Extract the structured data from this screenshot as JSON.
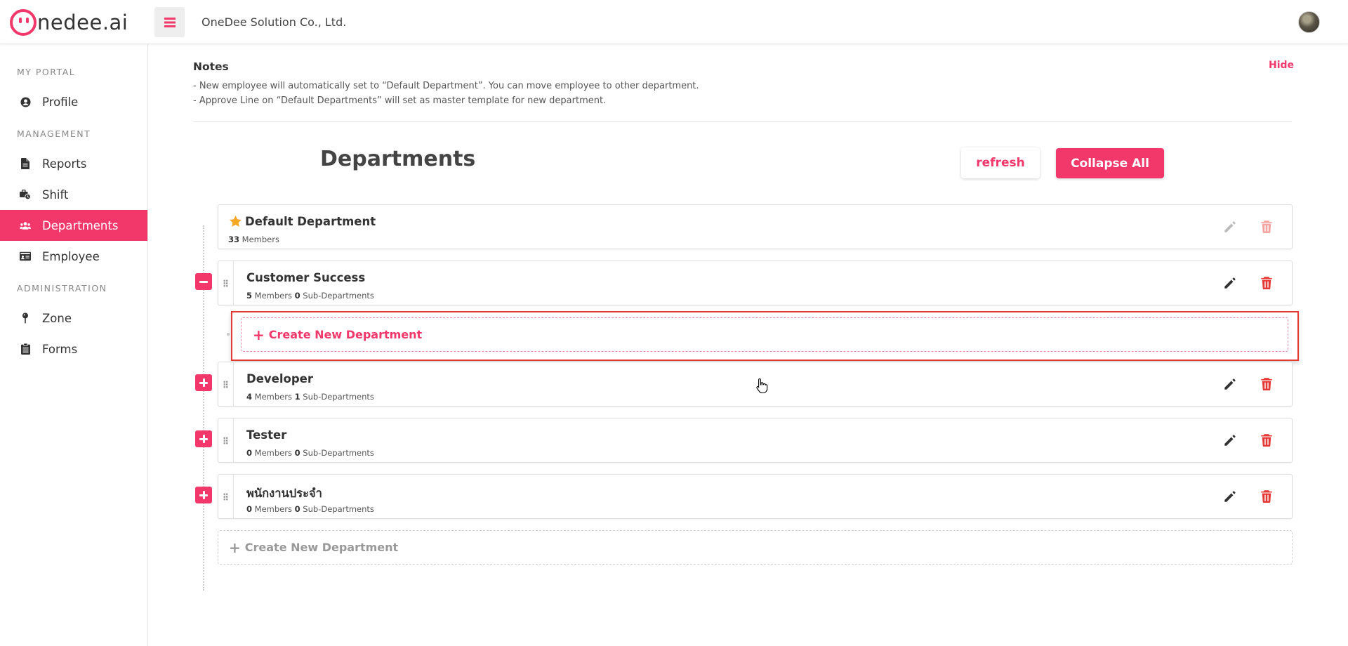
{
  "header": {
    "logo_text": "nedee.ai",
    "company": "OneDee Solution Co., Ltd."
  },
  "sidebar": {
    "sections": {
      "my_portal": "MY PORTAL",
      "management": "MANAGEMENT",
      "administration": "ADMINISTRATION"
    },
    "items": [
      {
        "label": "Profile",
        "icon": "user-circle-icon"
      },
      {
        "label": "Reports",
        "icon": "document-icon"
      },
      {
        "label": "Shift",
        "icon": "briefcase-clock-icon"
      },
      {
        "label": "Departments",
        "icon": "users-icon",
        "active": true
      },
      {
        "label": "Employee",
        "icon": "id-card-icon"
      },
      {
        "label": "Zone",
        "icon": "map-pin-icon"
      },
      {
        "label": "Forms",
        "icon": "clipboard-icon"
      }
    ]
  },
  "notes": {
    "title": "Notes",
    "hide": "Hide",
    "lines": [
      "- New employee will automatically set to “Default Department”. You can move employee to other department.",
      "- Approve Line on “Default Departments” will set as master template for new department."
    ]
  },
  "page": {
    "title": "Departments",
    "refresh": "refresh",
    "collapse_all": "Collapse All"
  },
  "departments": [
    {
      "name": "Default Department",
      "members": "33",
      "members_label": "Members"
    },
    {
      "name": "Customer Success",
      "members": "5",
      "members_label": "Members",
      "subs": "0",
      "subs_label": "Sub-Departments"
    },
    {
      "name": "Developer",
      "members": "4",
      "members_label": "Members",
      "subs": "1",
      "subs_label": "Sub-Departments"
    },
    {
      "name": "Tester",
      "members": "0",
      "members_label": "Members",
      "subs": "0",
      "subs_label": "Sub-Departments"
    },
    {
      "name": "พนักงานประจำ",
      "members": "0",
      "members_label": "Members",
      "subs": "0",
      "subs_label": "Sub-Departments"
    }
  ],
  "create": {
    "sub_label": "Create New Department",
    "root_label": "Create New Department"
  },
  "colors": {
    "accent": "#f2376b",
    "delete": "#e53935",
    "star": "#f5a623"
  }
}
